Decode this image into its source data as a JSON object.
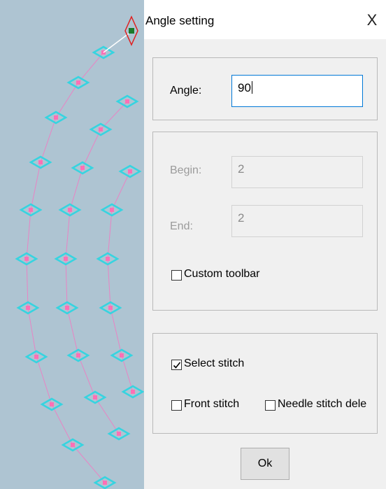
{
  "dialog": {
    "title": "Angle setting",
    "close_glyph": "X",
    "close_icon": "close-icon"
  },
  "angle_group": {
    "label": "Angle:",
    "value": "90"
  },
  "range_group": {
    "begin_label": "Begin:",
    "begin_value": "2",
    "end_label": "End:",
    "end_value": "2",
    "custom_toolbar_label": "Custom toolbar",
    "custom_toolbar_checked": false
  },
  "options_group": {
    "select_stitch_label": "Select stitch",
    "select_stitch_checked": true,
    "front_stitch_label": "Front stitch",
    "front_stitch_checked": false,
    "needle_stitch_label": "Needle stitch dele",
    "needle_stitch_checked": false
  },
  "ok_label": "Ok",
  "colors": {
    "canvas_bg": "#aec4d2",
    "stitch_marker": "#36d4e0",
    "stitch_point": "#ff6fb5",
    "stitch_line": "#e884c4",
    "selected_marker": "#e02020",
    "selected_point": "#1a7a2a",
    "focus_border": "#0078d7"
  }
}
